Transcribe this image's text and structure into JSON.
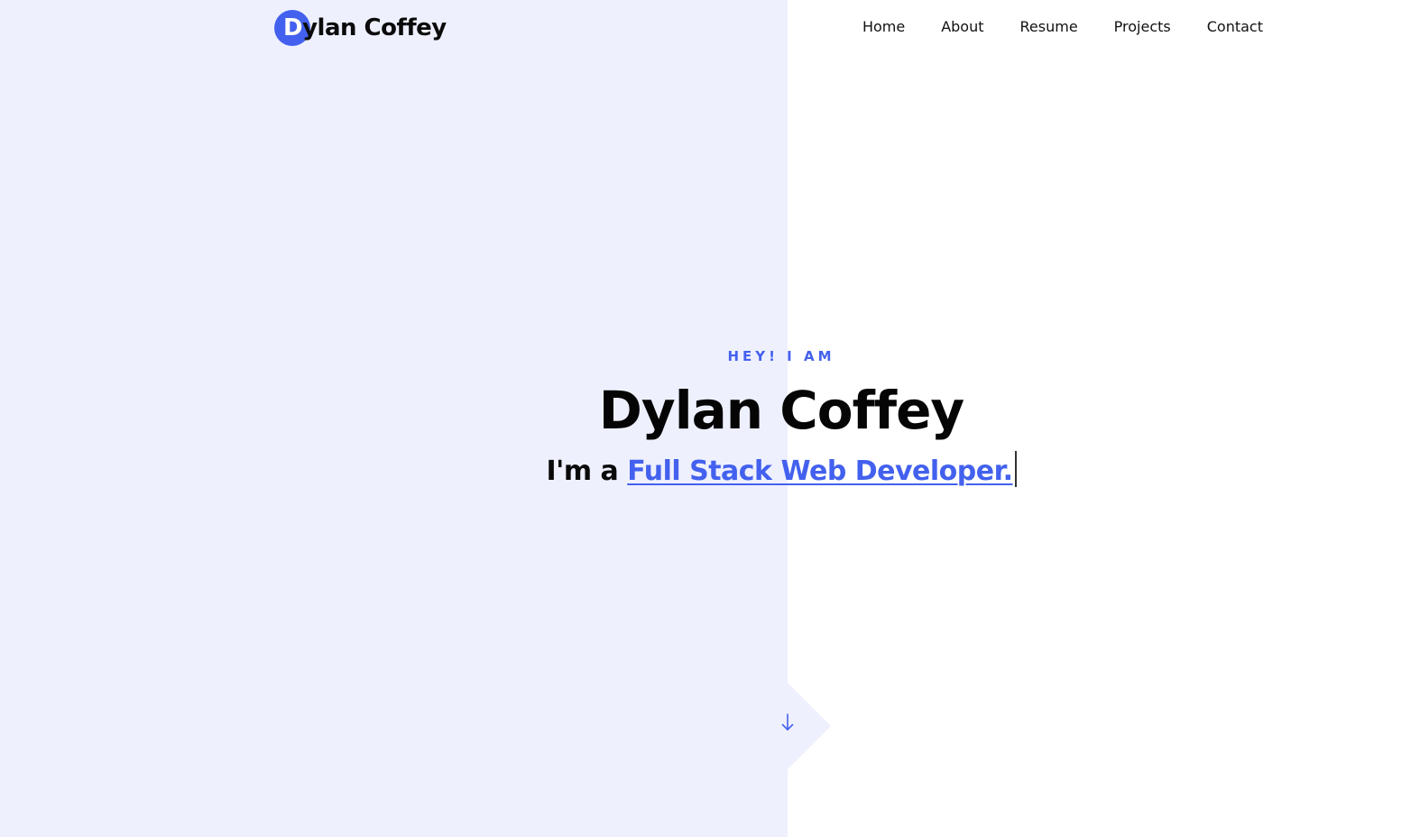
{
  "site": {
    "logo_initial": "D",
    "logo_rest": "ylan Coffey",
    "accent_color": "#4361ee",
    "panel_color": "#eef0fe"
  },
  "nav": {
    "items": [
      {
        "label": "Home"
      },
      {
        "label": "About"
      },
      {
        "label": "Resume"
      },
      {
        "label": "Projects"
      },
      {
        "label": "Contact"
      }
    ]
  },
  "hero": {
    "eyebrow": "HEY! I AM",
    "name": "Dylan Coffey",
    "tagline_prefix": "I'm a ",
    "tagline_role": "Full Stack Web Developer."
  },
  "scroll": {
    "icon": "arrow-down-icon"
  }
}
